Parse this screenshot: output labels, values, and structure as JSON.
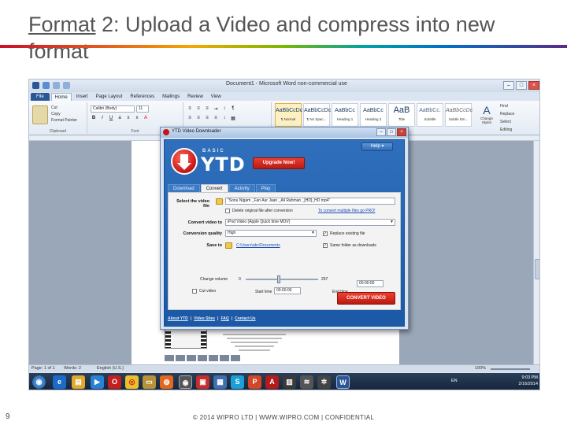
{
  "slide": {
    "title_prefix": "Format",
    "title_rest": " 2: Upload a Video and compress into new format",
    "page_number": "9",
    "footer": "© 2014 WIPRO LTD | WWW.WIPRO.COM | CONFIDENTIAL"
  },
  "word": {
    "window_title": "Document1 - Microsoft Word non-commercial use",
    "tabs": [
      "File",
      "Home",
      "Insert",
      "Page Layout",
      "References",
      "Mailings",
      "Review",
      "View"
    ],
    "active_tab": "Home",
    "clipboard": {
      "paste": "Paste",
      "cut": "Cut",
      "copy": "Copy",
      "format_painter": "Format Painter",
      "label": "Clipboard"
    },
    "font": {
      "name": "Calibri (Body)",
      "size": "11",
      "label": "Font"
    },
    "styles": [
      {
        "sample": "AaBbCcDc",
        "name": "¶ Normal"
      },
      {
        "sample": "AaBbCcDc",
        "name": "¶ No Spac..."
      },
      {
        "sample": "AaBbCc",
        "name": "Heading 1"
      },
      {
        "sample": "AaBbCc",
        "name": "Heading 2"
      },
      {
        "sample": "AaB",
        "name": "Title"
      },
      {
        "sample": "AaBbCc.",
        "name": "Subtitle"
      },
      {
        "sample": "AaBbCcDc",
        "name": "Subtle Em..."
      }
    ],
    "change_styles": "Change Styles",
    "editing": {
      "find": "Find",
      "replace": "Replace",
      "select": "Select",
      "label": "Editing"
    },
    "status": {
      "page": "Page: 1 of 1",
      "words": "Words: 2",
      "language": "English (U.S.)",
      "zoom": "100%"
    }
  },
  "ytd": {
    "window_title": "YTD Video Downloader",
    "logo_small": "BASIC",
    "logo_big": "YTD",
    "upgrade_label": "Upgrade Now!",
    "help_label": "Help ▾",
    "tabs": [
      "Download",
      "Convert",
      "Activity",
      "Play"
    ],
    "active_tab": "Convert",
    "select_label": "Select the video file",
    "select_value": "\"Sonu Nigam _Fan Aur Jaan _All Rahman _[HD]_HD mp4\"",
    "delete_label": "Delete original file after conversion",
    "multiple_link": "To convert multiple files go PRO!",
    "convert_to_label": "Convert video to",
    "convert_to_value": "iPod Video (Apple Quick time MOV)",
    "quality_label": "Conversion quality",
    "quality_value": "High",
    "replace_label": "Replace existing file",
    "save_label": "Save to",
    "save_value": "C:\\Users\\abc\\Documents",
    "same_folder_label": "Same folder as downloads",
    "change_volume_label": "Change volume",
    "volume_min": "0",
    "volume_max": "297",
    "cut_label": "Cut video",
    "start_label": "Start time",
    "start_value": "00:00:00",
    "end_label": "End time",
    "end_value": "00:00:00",
    "convert_button": "CONVERT VIDEO",
    "footer_links": [
      "About YTD",
      "Video Sites",
      "FAQ",
      "Contact Us"
    ]
  },
  "taskbar": {
    "language": "EN",
    "time": "9:03 PM",
    "date": "2/16/2014"
  },
  "colors": {
    "ytd_blue": "#1b59a7",
    "ytd_red": "#c91414",
    "word_ribbon": "#dbe5f1"
  }
}
